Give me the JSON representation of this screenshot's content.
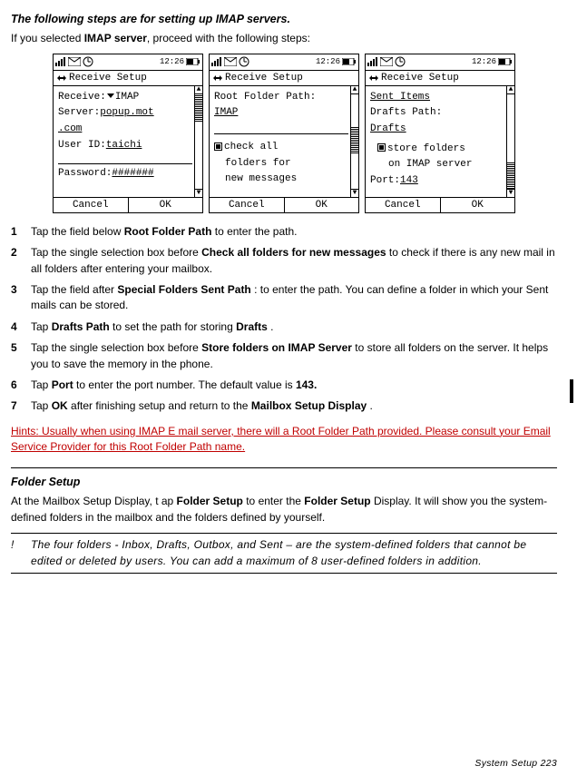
{
  "intro": {
    "heading": "The following steps are for setting up IMAP servers.",
    "line_prefix": "If you selected ",
    "line_bold": "IMAP server",
    "line_suffix": ", proceed with the following steps:"
  },
  "screens": {
    "time": "12:26",
    "title": "Receive Setup",
    "cancel": "Cancel",
    "ok": "OK",
    "s1": {
      "l1a": "Receive:",
      "l1b": "IMAP",
      "l2a": "Server:",
      "l2b": "popup.mot",
      "l3": ".com",
      "l4a": "User ID:",
      "l4b": "taichi",
      "l5a": "Password:",
      "l5b": "#######"
    },
    "s2": {
      "l1": "Root Folder Path:",
      "l2": "IMAP",
      "c1": "check all",
      "c2": "folders for",
      "c3": "new messages"
    },
    "s3": {
      "l1": "Sent Items",
      "l2": "Drafts Path:",
      "l3": "Drafts",
      "c1": "store folders",
      "c2": "on IMAP server",
      "p1": "Port:",
      "p2": "143"
    }
  },
  "steps": {
    "s1": {
      "n": "1",
      "a": "Tap the field below ",
      "b": "Root Folder Path",
      "c": " to enter the path."
    },
    "s2": {
      "n": "2",
      "a": "Tap the single selection box before ",
      "b": "Check all folders for new messages",
      "c": " to check if there is any new mail in all folders after entering your mailbox."
    },
    "s3": {
      "n": "3",
      "a": "Tap the field after ",
      "b": "Special Folders Sent Path",
      "c": " : to enter the path. You can define a folder in which your Sent mails can be stored."
    },
    "s4": {
      "n": "4",
      "a": "Tap ",
      "b": "Drafts Path",
      "c": " to set the path for storing ",
      "d": "Drafts",
      "e": " ."
    },
    "s5": {
      "n": "5",
      "a": "Tap the single selection box before ",
      "b": "Store folders on IMAP Server",
      "c": " to store all folders on the server. It helps you to save the memory in the phone."
    },
    "s6": {
      "n": "6",
      "a": "Tap ",
      "b": "Port",
      "c": " to enter the port number. The default value is ",
      "d": "143."
    },
    "s7": {
      "n": "7",
      "a": "Tap ",
      "b": "OK",
      "c": " after finishing  setup and return to the ",
      "d": "Mailbox Setup Display",
      "e": " ."
    }
  },
  "hints": {
    "label": "Hints:",
    "text": " Usually when using IMAP E mail server, there will a Root Folder Path provided. Please consult your Email Service Provider for this Root Folder Path name."
  },
  "folder": {
    "heading": "Folder Setup",
    "p_a": "At the Mailbox Setup Display, t ap ",
    "p_b": "Folder Setup",
    "p_c": " to enter the ",
    "p_d": "Folder Setup",
    "p_e": " Display. It will show you the system-defined folders in the mailbox and the folders defined by yourself."
  },
  "note": {
    "bang": "!",
    "text": "The four folders - Inbox, Drafts, Outbox, and Sent – are the system-defined folders that cannot be edited or deleted by users. You can add a maximum of 8 user-defined folders in addition."
  },
  "footer": "System Setup   223"
}
